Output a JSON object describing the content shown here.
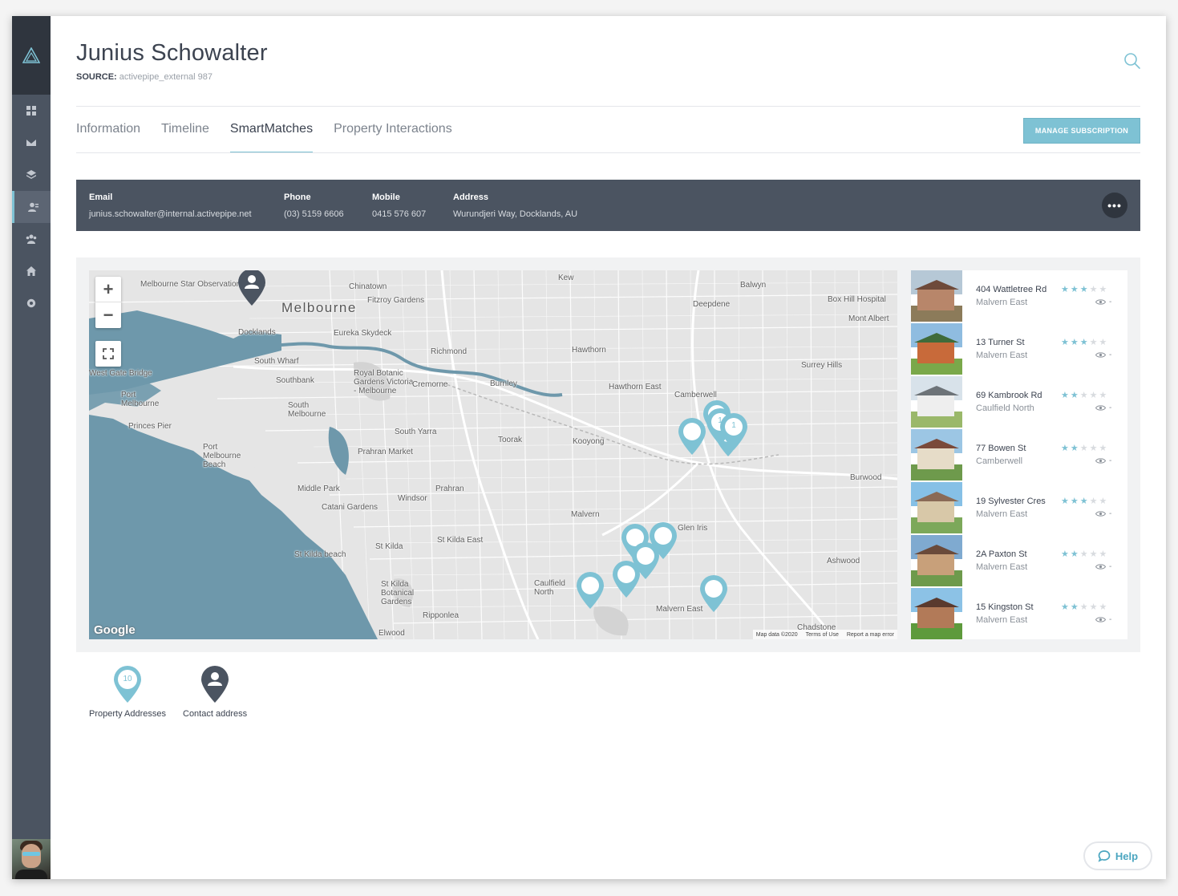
{
  "contact": {
    "name": "Junius Schowalter",
    "source_label": "SOURCE:",
    "source_value": "activepipe_external 987"
  },
  "tabs": [
    {
      "label": "Information",
      "active": false
    },
    {
      "label": "Timeline",
      "active": false
    },
    {
      "label": "SmartMatches",
      "active": true
    },
    {
      "label": "Property Interactions",
      "active": false
    }
  ],
  "manage_button": "MANAGE SUBSCRIPTION",
  "contact_bar": {
    "email_label": "Email",
    "email": "junius.schowalter@internal.activepipe.net",
    "phone_label": "Phone",
    "phone": "(03) 5159 6606",
    "mobile_label": "Mobile",
    "mobile": "0415 576 607",
    "address_label": "Address",
    "address": "Wurundjeri Way, Docklands, AU",
    "more_label": "•••"
  },
  "map": {
    "labels": [
      "Melbourne Star Observation Wheel",
      "Chinatown",
      "Melbourne",
      "Fitzroy Gardens",
      "Kew",
      "Balwyn",
      "Deepdene",
      "Box Hill Hospital",
      "Mont Albert",
      "Docklands",
      "Eureka Skydeck",
      "Richmond",
      "Hawthorn",
      "Surrey Hills",
      "West Gate Bridge",
      "South Wharf",
      "Southbank",
      "Royal Botanic Gardens Victoria - Melbourne",
      "Cremorne",
      "Burnley",
      "Hawthorn East",
      "Camberwell",
      "Port Melbourne",
      "South Melbourne",
      "Princes Pier",
      "South Yarra",
      "Toorak",
      "Kooyong",
      "Port Melbourne Beach",
      "Prahran Market",
      "Burwood",
      "Middle Park",
      "Prahran",
      "Windsor",
      "Catani Gardens",
      "Malvern",
      "Glen Iris",
      "St Kilda East",
      "St Kilda",
      "St Kilda beach",
      "Ashwood",
      "Caulfield North",
      "St Kilda Botanical Gardens",
      "Ripponlea",
      "Malvern East",
      "Elwood",
      "Chadstone"
    ],
    "footer": [
      "Map data ©2020",
      "Terms of Use",
      "Report a map error"
    ],
    "google": "Google",
    "cluster_counts": [
      "1",
      "1"
    ]
  },
  "properties": [
    {
      "address": "404 Wattletree Rd",
      "suburb": "Malvern East",
      "stars": 3,
      "views": "-",
      "sky": "#b6c8d6",
      "wall": "#b8866a",
      "roof": "#6e4a3a",
      "grass": "#8c7b5a"
    },
    {
      "address": "13 Turner St",
      "suburb": "Malvern East",
      "stars": 3,
      "views": "-",
      "sky": "#8fbce0",
      "wall": "#c86a3a",
      "roof": "#3f6b3a",
      "grass": "#7aa84a"
    },
    {
      "address": "69 Kambrook Rd",
      "suburb": "Caulfield North",
      "stars": 2,
      "views": "-",
      "sky": "#d8e2ea",
      "wall": "#eeeeee",
      "roof": "#6d7378",
      "grass": "#9ab86a"
    },
    {
      "address": "77 Bowen St",
      "suburb": "Camberwell",
      "stars": 2,
      "views": "-",
      "sky": "#9cc6e4",
      "wall": "#e6dcc8",
      "roof": "#7a4a3a",
      "grass": "#6e9a4c"
    },
    {
      "address": "19 Sylvester Cres",
      "suburb": "Malvern East",
      "stars": 3,
      "views": "-",
      "sky": "#86c0e6",
      "wall": "#d8c8a8",
      "roof": "#8a6a56",
      "grass": "#7ca85a"
    },
    {
      "address": "2A Paxton St",
      "suburb": "Malvern East",
      "stars": 2,
      "views": "-",
      "sky": "#7faad0",
      "wall": "#c8a07a",
      "roof": "#6a4a3a",
      "grass": "#6e9a4c"
    },
    {
      "address": "15 Kingston St",
      "suburb": "Malvern East",
      "stars": 2,
      "views": "-",
      "sky": "#8cc2e6",
      "wall": "#b27a58",
      "roof": "#5a3a2e",
      "grass": "#5e9a3c"
    }
  ],
  "legend": {
    "property_count": "10",
    "property_label": "Property Addresses",
    "contact_label": "Contact address"
  },
  "help_label": "Help",
  "colors": {
    "accent": "#7ec2d4",
    "sidebar": "#4b5461",
    "dark": "#2f353e",
    "water": "#6e98ab"
  }
}
